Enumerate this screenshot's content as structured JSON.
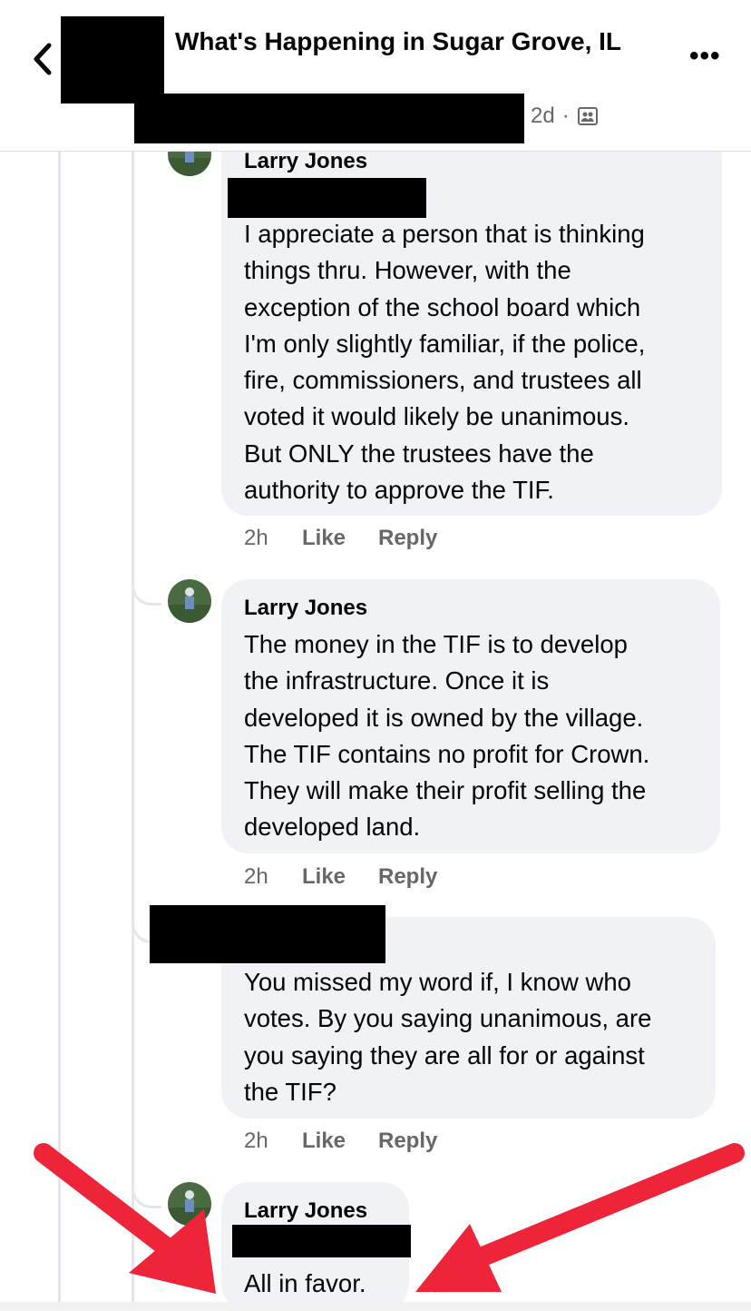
{
  "header": {
    "title": "What's Happening in Sugar Grove, IL",
    "time": "2d",
    "dot": "·"
  },
  "comments": [
    {
      "author": "Larry Jones",
      "text": "I appreciate a person that is thinking\nthings thru. However, with the\nexception of the school board which\nI'm only slightly familiar, if the police,\nfire, commissioners, and trustees all\nvoted it would likely be unanimous.\nBut ONLY the trustees have the\nauthority to approve the TIF.",
      "time": "2h",
      "like": "Like",
      "reply": "Reply"
    },
    {
      "author": "Larry Jones",
      "text": "The money in the TIF is to develop\nthe infrastructure. Once it is\ndeveloped it is owned by the village.\nThe TIF contains no profit for Crown.\nThey will make their profit selling the\ndeveloped land.",
      "time": "2h",
      "like": "Like",
      "reply": "Reply"
    },
    {
      "author": "",
      "text": "You missed my word if, I know who\nvotes. By you saying unanimous, are\nyou saying they are all for or against\nthe TIF?",
      "time": "2h",
      "like": "Like",
      "reply": "Reply"
    },
    {
      "author": "Larry Jones",
      "text": "All in favor.",
      "time": "",
      "like": "",
      "reply": ""
    }
  ],
  "colors": {
    "annotation_arrow": "#ee2438",
    "bubble": "#f0f2f5",
    "meta_text": "#65676b"
  },
  "icons": [
    "back-chevron-icon",
    "more-dots-icon",
    "group-privacy-icon",
    "avatar"
  ]
}
